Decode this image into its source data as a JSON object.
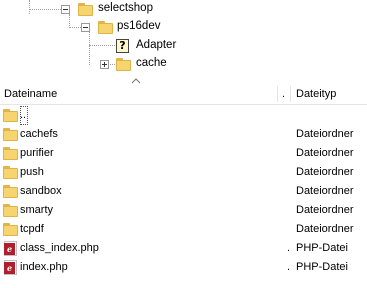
{
  "tree": {
    "nodes": [
      {
        "label": "selectshop"
      },
      {
        "label": "ps16dev"
      },
      {
        "label": "Adapter"
      },
      {
        "label": "cache"
      }
    ]
  },
  "header": {
    "name_label": "Dateiname",
    "dot_label": ".",
    "type_label": "Dateityp"
  },
  "rows": [
    {
      "name": "..",
      "dot": "",
      "type": "",
      "icon": "folder-icon"
    },
    {
      "name": "cachefs",
      "dot": "",
      "type": "Dateiordner",
      "icon": "folder-icon"
    },
    {
      "name": "purifier",
      "dot": "",
      "type": "Dateiordner",
      "icon": "folder-icon"
    },
    {
      "name": "push",
      "dot": "",
      "type": "Dateiordner",
      "icon": "folder-icon"
    },
    {
      "name": "sandbox",
      "dot": "",
      "type": "Dateiordner",
      "icon": "folder-icon"
    },
    {
      "name": "smarty",
      "dot": "",
      "type": "Dateiordner",
      "icon": "folder-icon"
    },
    {
      "name": "tcpdf",
      "dot": "",
      "type": "Dateiordner",
      "icon": "folder-icon"
    },
    {
      "name": "class_index.php",
      "dot": ".",
      "type": "PHP-Datei",
      "icon": "php-file-icon"
    },
    {
      "name": "index.php",
      "dot": ".",
      "type": "PHP-Datei",
      "icon": "php-file-icon"
    }
  ],
  "colors": {
    "folder": "#f6d470",
    "folder_border": "#e0b345",
    "php_badge": "#b11d2b"
  }
}
